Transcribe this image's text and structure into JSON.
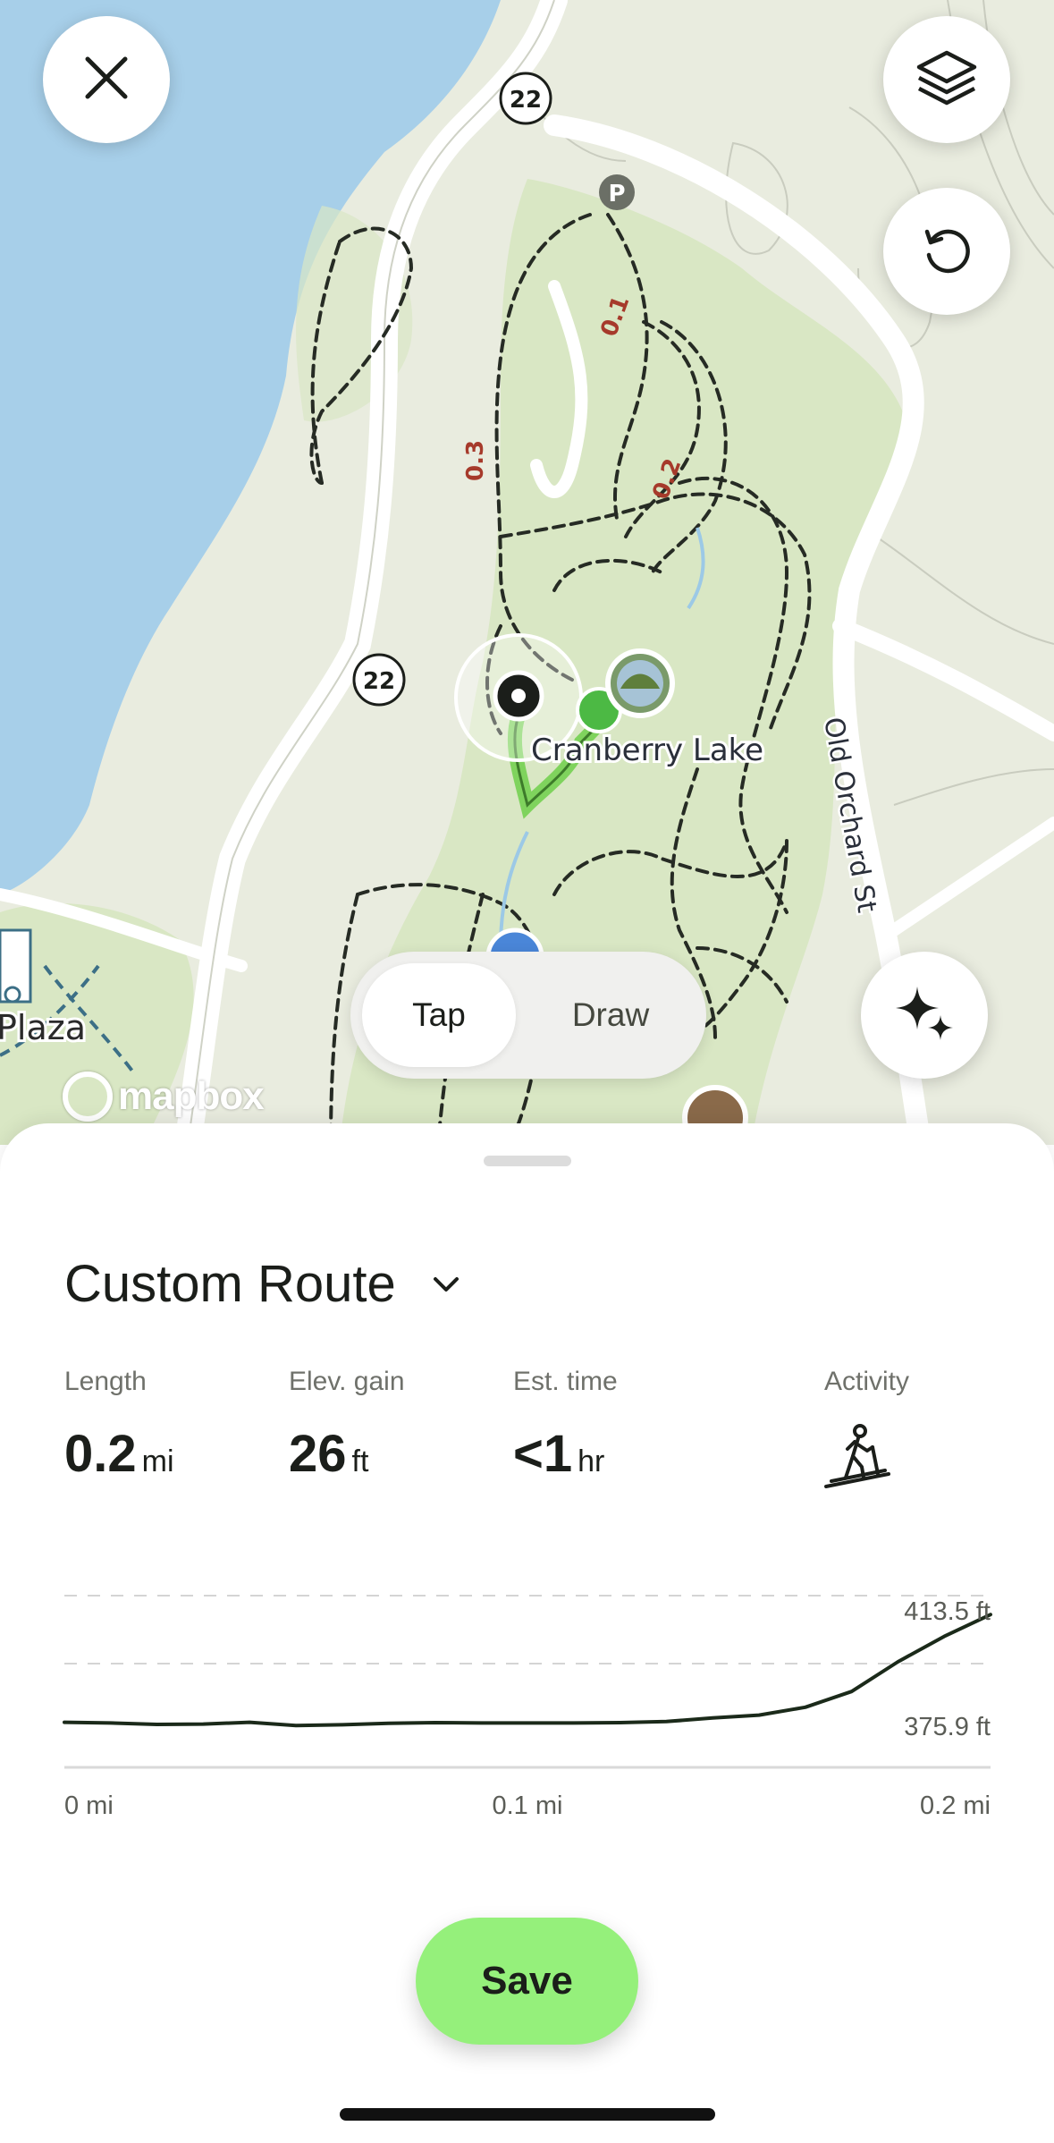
{
  "map": {
    "lake_label": "Cranberry Lake",
    "road_label": "Old Orchard St",
    "place_label": "Plaza",
    "route_shields": [
      "22",
      "22"
    ],
    "parking_label": "P",
    "trail_markers": [
      "0.1",
      "0.2",
      "0.3"
    ],
    "attribution": "mapbox",
    "water_color": "#a7cfe9",
    "park_color": "#d9e7c4",
    "route_color": "#7fd35d"
  },
  "buttons": {
    "close_icon": "close-icon",
    "layers_icon": "layers-icon",
    "undo_icon": "undo-icon",
    "sparkle_icon": "sparkle-icon"
  },
  "mode_toggle": {
    "tap_label": "Tap",
    "draw_label": "Draw",
    "selected": "Tap"
  },
  "route": {
    "title": "Custom Route",
    "stats": {
      "length_label": "Length",
      "length_value": "0.2",
      "length_unit": "mi",
      "elev_label": "Elev. gain",
      "elev_value": "26",
      "elev_unit": "ft",
      "time_label": "Est. time",
      "time_value": "<1",
      "time_unit": "hr",
      "activity_label": "Activity",
      "activity_icon": "hiking-icon"
    }
  },
  "chart_data": {
    "type": "area",
    "x": [
      0,
      0.01,
      0.02,
      0.03,
      0.04,
      0.05,
      0.06,
      0.07,
      0.08,
      0.09,
      0.1,
      0.11,
      0.12,
      0.13,
      0.14,
      0.15,
      0.16,
      0.17,
      0.18,
      0.19,
      0.2
    ],
    "y": [
      378.6,
      378.4,
      378.0,
      378.1,
      378.6,
      377.7,
      377.9,
      378.3,
      378.5,
      378.4,
      378.4,
      378.4,
      378.5,
      378.8,
      379.8,
      380.6,
      382.8,
      387.2,
      395.5,
      402.6,
      408.7
    ],
    "series_color": "#1b2a1a",
    "max_label": "413.5 ft",
    "min_label": "375.9 ft",
    "x_tick_labels": [
      "0 mi",
      "0.1 mi",
      "0.2 mi"
    ],
    "xlim": [
      0,
      0.2
    ],
    "ylim": [
      366,
      426
    ],
    "grid": true
  },
  "save_label": "Save"
}
